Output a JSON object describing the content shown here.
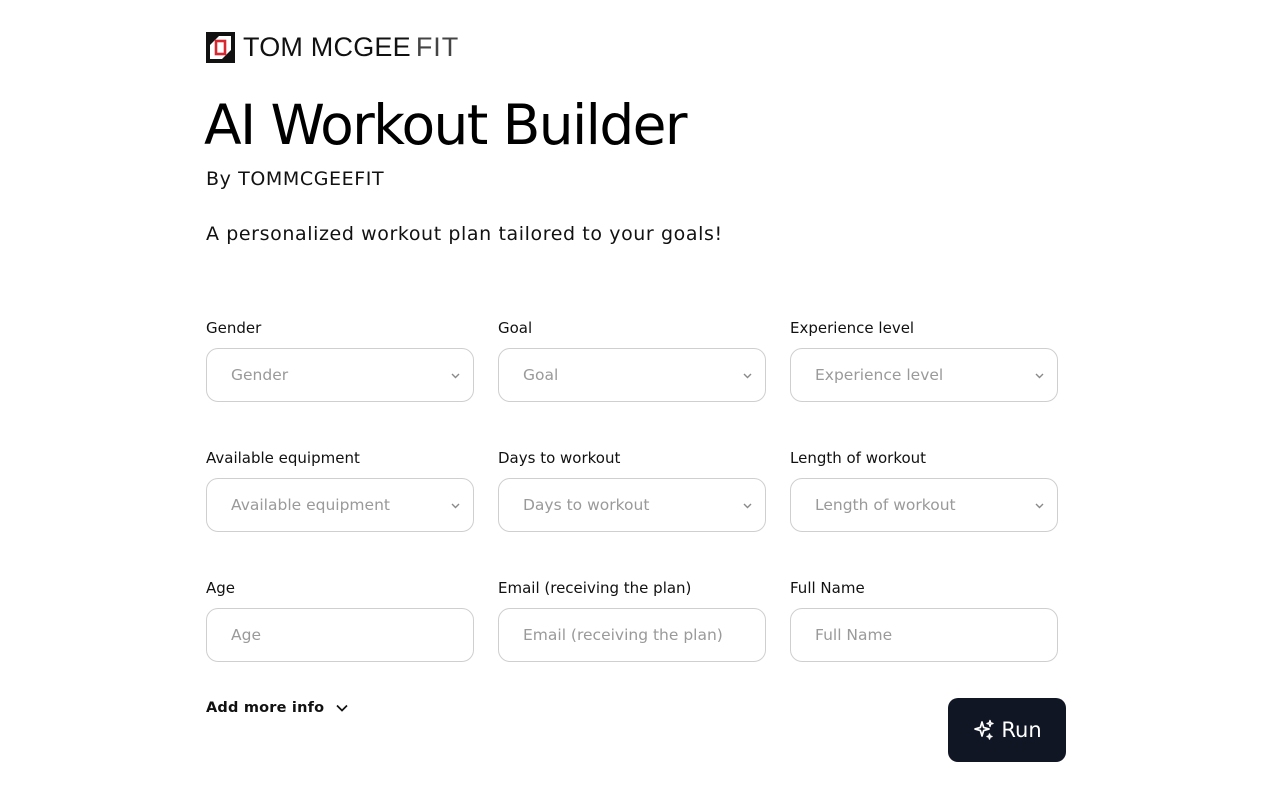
{
  "brand": {
    "name_bold": "TOM MCGEE",
    "name_thin": "FIT",
    "accent": "#d8272f"
  },
  "hero": {
    "title": "AI Workout Builder",
    "byline": "By TOMMCGEEFIT",
    "tagline": "A personalized workout plan tailored to your goals!"
  },
  "form": {
    "gender": {
      "label": "Gender",
      "placeholder": "Gender"
    },
    "goal": {
      "label": "Goal",
      "placeholder": "Goal"
    },
    "experience": {
      "label": "Experience level",
      "placeholder": "Experience level"
    },
    "equipment": {
      "label": "Available equipment",
      "placeholder": "Available equipment"
    },
    "days": {
      "label": "Days to workout",
      "placeholder": "Days to workout"
    },
    "length": {
      "label": "Length of workout",
      "placeholder": "Length of workout"
    },
    "age": {
      "label": "Age",
      "placeholder": "Age"
    },
    "email": {
      "label": "Email (receiving the plan)",
      "placeholder": "Email (receiving the plan)"
    },
    "full_name": {
      "label": "Full Name",
      "placeholder": "Full Name"
    }
  },
  "more_info": {
    "label": "Add more info",
    "icon": "chevron-down-icon"
  },
  "run_button": {
    "label": "Run",
    "icon": "sparkles-icon",
    "bg": "#101624"
  }
}
